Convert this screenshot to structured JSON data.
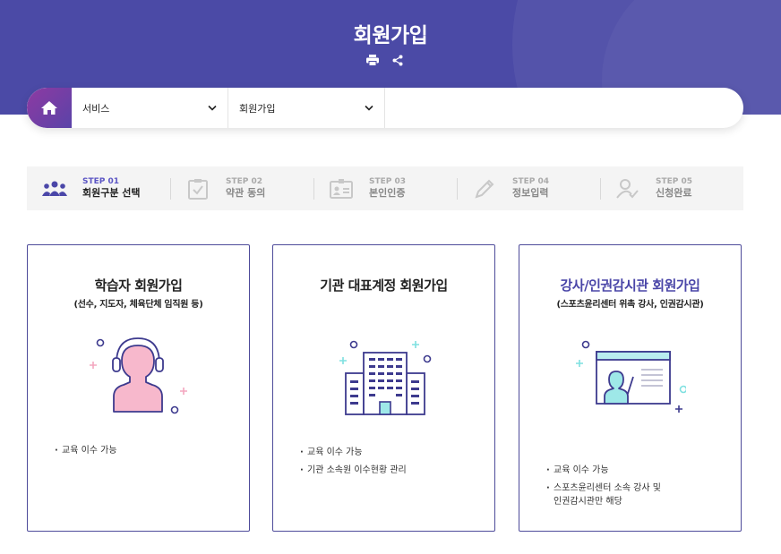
{
  "header": {
    "title": "회원가입"
  },
  "icons": {
    "print": "print-icon",
    "share": "share-icon",
    "home": "home-icon",
    "chevron": "chevron-down-icon"
  },
  "breadcrumb": {
    "level1": "서비스",
    "level2": "회원가입"
  },
  "steps": [
    {
      "num": "STEP 01",
      "label": "회원구분 선택",
      "icon": "users-icon"
    },
    {
      "num": "STEP 02",
      "label": "약관 동의",
      "icon": "clipboard-check-icon"
    },
    {
      "num": "STEP 03",
      "label": "본인인증",
      "icon": "id-card-icon"
    },
    {
      "num": "STEP 04",
      "label": "정보입력",
      "icon": "pencil-icon"
    },
    {
      "num": "STEP 05",
      "label": "신청완료",
      "icon": "user-check-icon"
    }
  ],
  "cards": [
    {
      "title": "학습자 회원가입",
      "subtitle": "(선수, 지도자, 체육단체 임직원 등)",
      "features": [
        "교육 이수 가능"
      ]
    },
    {
      "title": "기관 대표계정 회원가입",
      "subtitle": "",
      "features": [
        "교육 이수 가능",
        "기관 소속원 이수현황 관리"
      ]
    },
    {
      "title": "강사/인권감시관 회원가입",
      "subtitle": "(스포츠윤리센터 위촉 강사, 인권감시관)",
      "features": [
        "교육 이수 가능",
        "스포츠윤리센터 소속 강사 및",
        "인권감시관만 해당"
      ]
    }
  ],
  "colors": {
    "hero": "#4b4aa6",
    "accent": "#5b55c4",
    "card_border": "#4e4b9a",
    "pink": "#f7b3c8",
    "mint": "#7fe0e0"
  }
}
